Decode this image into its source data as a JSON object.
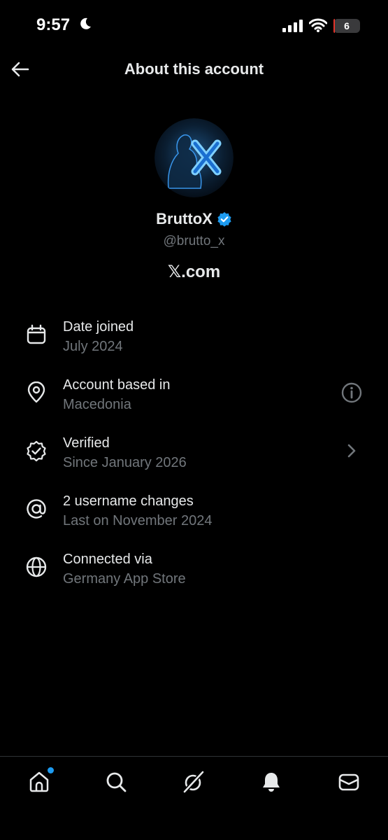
{
  "status_bar": {
    "time": "9:57",
    "battery_level": "6",
    "battery_fraction": 0.06
  },
  "header": {
    "title": "About this account",
    "back_icon": "arrow-left-icon"
  },
  "profile": {
    "display_name": "BruttoX",
    "handle": "@brutto_x",
    "site": "𝕏.com",
    "verified_badge_color": "#1d9bf0"
  },
  "info_items": [
    {
      "icon": "calendar-icon",
      "title": "Date joined",
      "subtitle": "July 2024"
    },
    {
      "icon": "location-pin-icon",
      "title": "Account based in",
      "subtitle": "Macedonia",
      "trailing": "info-icon"
    },
    {
      "icon": "verified-badge-outline-icon",
      "title": "Verified",
      "subtitle": "Since January 2026",
      "trailing": "chevron-right-icon"
    },
    {
      "icon": "at-sign-icon",
      "title": "2 username changes",
      "subtitle": "Last on November 2024"
    },
    {
      "icon": "globe-icon",
      "title": "Connected via",
      "subtitle": "Germany App Store"
    }
  ],
  "tab_bar": {
    "tabs": [
      "home-icon",
      "search-icon",
      "grok-icon",
      "notifications-bell-icon",
      "messages-icon"
    ],
    "notification_dot_color": "#1d9bf0"
  },
  "colors": {
    "background": "#000000",
    "primary_text": "#e7e9ea",
    "secondary_text": "#71767b",
    "accent": "#1d9bf0"
  }
}
